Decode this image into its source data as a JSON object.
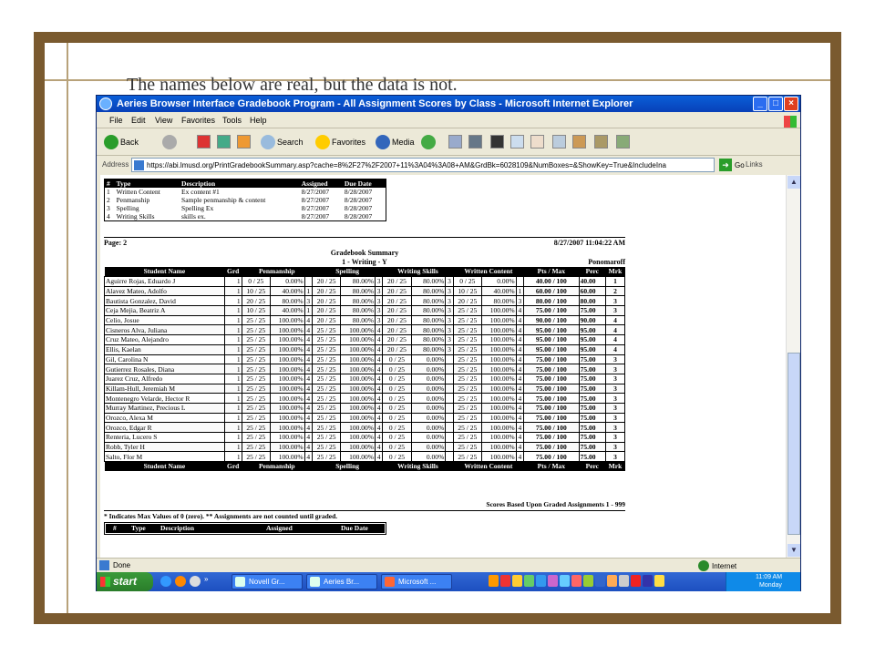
{
  "caption": "The names below are real, but the data is not.",
  "window": {
    "title": "Aeries Browser Interface Gradebook Program - All Assignment Scores by Class - Microsoft Internet Explorer",
    "buttons": {
      "minimize": "_",
      "maximize": "□",
      "close": "×"
    }
  },
  "menu": [
    "File",
    "Edit",
    "View",
    "Favorites",
    "Tools",
    "Help"
  ],
  "toolbar": {
    "back": "Back",
    "search": "Search",
    "favorites": "Favorites",
    "media": "Media"
  },
  "address": {
    "label": "Address",
    "url": "https://abi.lmusd.org/PrintGradebookSummary.asp?cache=8%2F27%2F2007+11%3A04%3A08+AM&GrdBk=6028109&NumBoxes=&ShowKey=True&IncludeIna",
    "go": "Go",
    "links": "Links"
  },
  "assignments_key": {
    "headers": [
      "#",
      "Type",
      "Description",
      "Assigned",
      "Due Date"
    ],
    "rows": [
      [
        "1",
        "Written Content",
        "Ex content #1",
        "8/27/2007",
        "8/28/2007"
      ],
      [
        "2",
        "Penmanship",
        "Sample penmanship & content",
        "8/27/2007",
        "8/28/2007"
      ],
      [
        "3",
        "Spelling",
        "Spelling Ex",
        "8/27/2007",
        "8/28/2007"
      ],
      [
        "4",
        "Writing Skills",
        "skills ex.",
        "8/27/2007",
        "8/28/2007"
      ]
    ]
  },
  "report": {
    "page": "Page: 2",
    "datetime": "8/27/2007 11:04:22 AM",
    "title": "Gradebook Summary",
    "subtitle": "1 - Writing - Y",
    "teacher": "Ponomaroff",
    "headers": [
      "Student Name",
      "Grd",
      "Penmanship",
      "Spelling",
      "Writing Skills",
      "Written Content",
      "Pts / Max",
      "Perc",
      "Mrk"
    ],
    "students": [
      {
        "name": "Aguirre Rojas, Eduardo J",
        "grd": "1",
        "pen": [
          "0 / 25",
          "0.00%",
          ""
        ],
        "spl": [
          "20 / 25",
          "80.00%",
          "3"
        ],
        "ws": [
          "20 / 25",
          "80.00%",
          "3"
        ],
        "wc": [
          "0 / 25",
          "0.00%",
          ""
        ],
        "pts": "40.00 / 100",
        "perc": "40.00",
        "mrk": "1"
      },
      {
        "name": "Alavez Mateo, Adolfo",
        "grd": "1",
        "pen": [
          "10 / 25",
          "40.00%",
          "1"
        ],
        "spl": [
          "20 / 25",
          "80.00%",
          "3"
        ],
        "ws": [
          "20 / 25",
          "80.00%",
          "3"
        ],
        "wc": [
          "10 / 25",
          "40.00%",
          "1"
        ],
        "pts": "60.00 / 100",
        "perc": "60.00",
        "mrk": "2"
      },
      {
        "name": "Bautista Gonzalez, David",
        "grd": "1",
        "pen": [
          "20 / 25",
          "80.00%",
          "3"
        ],
        "spl": [
          "20 / 25",
          "80.00%",
          "3"
        ],
        "ws": [
          "20 / 25",
          "80.00%",
          "3"
        ],
        "wc": [
          "20 / 25",
          "80.00%",
          "3"
        ],
        "pts": "80.00 / 100",
        "perc": "80.00",
        "mrk": "3"
      },
      {
        "name": "Ceja Mejia, Beatriz A",
        "grd": "1",
        "pen": [
          "10 / 25",
          "40.00%",
          "1"
        ],
        "spl": [
          "20 / 25",
          "80.00%",
          "3"
        ],
        "ws": [
          "20 / 25",
          "80.00%",
          "3"
        ],
        "wc": [
          "25 / 25",
          "100.00%",
          "4"
        ],
        "pts": "75.00 / 100",
        "perc": "75.00",
        "mrk": "3"
      },
      {
        "name": "Celio, Josue",
        "grd": "1",
        "pen": [
          "25 / 25",
          "100.00%",
          "4"
        ],
        "spl": [
          "20 / 25",
          "80.00%",
          "3"
        ],
        "ws": [
          "20 / 25",
          "80.00%",
          "3"
        ],
        "wc": [
          "25 / 25",
          "100.00%",
          "4"
        ],
        "pts": "90.00 / 100",
        "perc": "90.00",
        "mrk": "4"
      },
      {
        "name": "Cisneros Alva, Juliana",
        "grd": "1",
        "pen": [
          "25 / 25",
          "100.00%",
          "4"
        ],
        "spl": [
          "25 / 25",
          "100.00%",
          "4"
        ],
        "ws": [
          "20 / 25",
          "80.00%",
          "3"
        ],
        "wc": [
          "25 / 25",
          "100.00%",
          "4"
        ],
        "pts": "95.00 / 100",
        "perc": "95.00",
        "mrk": "4"
      },
      {
        "name": "Cruz Mateo, Alejandro",
        "grd": "1",
        "pen": [
          "25 / 25",
          "100.00%",
          "4"
        ],
        "spl": [
          "25 / 25",
          "100.00%",
          "4"
        ],
        "ws": [
          "20 / 25",
          "80.00%",
          "3"
        ],
        "wc": [
          "25 / 25",
          "100.00%",
          "4"
        ],
        "pts": "95.00 / 100",
        "perc": "95.00",
        "mrk": "4"
      },
      {
        "name": "Ellis, Kaelan",
        "grd": "1",
        "pen": [
          "25 / 25",
          "100.00%",
          "4"
        ],
        "spl": [
          "25 / 25",
          "100.00%",
          "4"
        ],
        "ws": [
          "20 / 25",
          "80.00%",
          "3"
        ],
        "wc": [
          "25 / 25",
          "100.00%",
          "4"
        ],
        "pts": "95.00 / 100",
        "perc": "95.00",
        "mrk": "4"
      },
      {
        "name": "Gil, Carolina N",
        "grd": "1",
        "pen": [
          "25 / 25",
          "100.00%",
          "4"
        ],
        "spl": [
          "25 / 25",
          "100.00%",
          "4"
        ],
        "ws": [
          "0 / 25",
          "0.00%",
          ""
        ],
        "wc": [
          "25 / 25",
          "100.00%",
          "4"
        ],
        "pts": "75.00 / 100",
        "perc": "75.00",
        "mrk": "3"
      },
      {
        "name": "Gutierrez Rosales, Diana",
        "grd": "1",
        "pen": [
          "25 / 25",
          "100.00%",
          "4"
        ],
        "spl": [
          "25 / 25",
          "100.00%",
          "4"
        ],
        "ws": [
          "0 / 25",
          "0.00%",
          ""
        ],
        "wc": [
          "25 / 25",
          "100.00%",
          "4"
        ],
        "pts": "75.00 / 100",
        "perc": "75.00",
        "mrk": "3"
      },
      {
        "name": "Juarez Cruz, Alfredo",
        "grd": "1",
        "pen": [
          "25 / 25",
          "100.00%",
          "4"
        ],
        "spl": [
          "25 / 25",
          "100.00%",
          "4"
        ],
        "ws": [
          "0 / 25",
          "0.00%",
          ""
        ],
        "wc": [
          "25 / 25",
          "100.00%",
          "4"
        ],
        "pts": "75.00 / 100",
        "perc": "75.00",
        "mrk": "3"
      },
      {
        "name": "Killam-Hull, Jeremiah M",
        "grd": "1",
        "pen": [
          "25 / 25",
          "100.00%",
          "4"
        ],
        "spl": [
          "25 / 25",
          "100.00%",
          "4"
        ],
        "ws": [
          "0 / 25",
          "0.00%",
          ""
        ],
        "wc": [
          "25 / 25",
          "100.00%",
          "4"
        ],
        "pts": "75.00 / 100",
        "perc": "75.00",
        "mrk": "3"
      },
      {
        "name": "Montenegro Velarde, Hector R",
        "grd": "1",
        "pen": [
          "25 / 25",
          "100.00%",
          "4"
        ],
        "spl": [
          "25 / 25",
          "100.00%",
          "4"
        ],
        "ws": [
          "0 / 25",
          "0.00%",
          ""
        ],
        "wc": [
          "25 / 25",
          "100.00%",
          "4"
        ],
        "pts": "75.00 / 100",
        "perc": "75.00",
        "mrk": "3"
      },
      {
        "name": "Murray Martinez, Precious L",
        "grd": "1",
        "pen": [
          "25 / 25",
          "100.00%",
          "4"
        ],
        "spl": [
          "25 / 25",
          "100.00%",
          "4"
        ],
        "ws": [
          "0 / 25",
          "0.00%",
          ""
        ],
        "wc": [
          "25 / 25",
          "100.00%",
          "4"
        ],
        "pts": "75.00 / 100",
        "perc": "75.00",
        "mrk": "3"
      },
      {
        "name": "Orozco, Alexa M",
        "grd": "1",
        "pen": [
          "25 / 25",
          "100.00%",
          "4"
        ],
        "spl": [
          "25 / 25",
          "100.00%",
          "4"
        ],
        "ws": [
          "0 / 25",
          "0.00%",
          ""
        ],
        "wc": [
          "25 / 25",
          "100.00%",
          "4"
        ],
        "pts": "75.00 / 100",
        "perc": "75.00",
        "mrk": "3"
      },
      {
        "name": "Orozco, Edgar R",
        "grd": "1",
        "pen": [
          "25 / 25",
          "100.00%",
          "4"
        ],
        "spl": [
          "25 / 25",
          "100.00%",
          "4"
        ],
        "ws": [
          "0 / 25",
          "0.00%",
          ""
        ],
        "wc": [
          "25 / 25",
          "100.00%",
          "4"
        ],
        "pts": "75.00 / 100",
        "perc": "75.00",
        "mrk": "3"
      },
      {
        "name": "Renteria, Lucero S",
        "grd": "1",
        "pen": [
          "25 / 25",
          "100.00%",
          "4"
        ],
        "spl": [
          "25 / 25",
          "100.00%",
          "4"
        ],
        "ws": [
          "0 / 25",
          "0.00%",
          ""
        ],
        "wc": [
          "25 / 25",
          "100.00%",
          "4"
        ],
        "pts": "75.00 / 100",
        "perc": "75.00",
        "mrk": "3"
      },
      {
        "name": "Robb, Tyler H",
        "grd": "1",
        "pen": [
          "25 / 25",
          "100.00%",
          "4"
        ],
        "spl": [
          "25 / 25",
          "100.00%",
          "4"
        ],
        "ws": [
          "0 / 25",
          "0.00%",
          ""
        ],
        "wc": [
          "25 / 25",
          "100.00%",
          "4"
        ],
        "pts": "75.00 / 100",
        "perc": "75.00",
        "mrk": "3"
      },
      {
        "name": "Salto, Flor M",
        "grd": "1",
        "pen": [
          "25 / 25",
          "100.00%",
          "4"
        ],
        "spl": [
          "25 / 25",
          "100.00%",
          "4"
        ],
        "ws": [
          "0 / 25",
          "0.00%",
          ""
        ],
        "wc": [
          "25 / 25",
          "100.00%",
          "4"
        ],
        "pts": "75.00 / 100",
        "perc": "75.00",
        "mrk": "3"
      }
    ],
    "scores_based": "Scores Based Upon Graded Assignments 1 - 999",
    "footnote": "* Indicates Max Values of 0 (zero).   ** Assignments are not counted until graded."
  },
  "status": {
    "text": "Done",
    "zone": "Internet"
  },
  "taskbar": {
    "start": "start",
    "tasks": [
      "Novell Gr...",
      "Aeries Br...",
      "Microsoft ..."
    ],
    "time": "11:09 AM",
    "day": "Monday",
    "chevron": "»"
  },
  "colors": {
    "frame": "#7a5a2f",
    "xp_blue": "#0a5fd8",
    "taskbar": "#3168d5",
    "start_green": "#3a9a3a"
  }
}
